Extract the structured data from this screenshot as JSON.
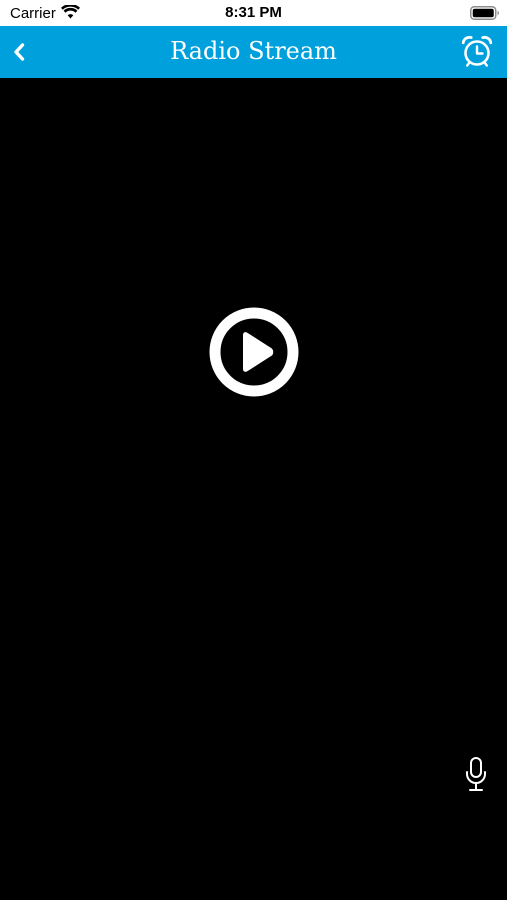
{
  "status_bar": {
    "carrier": "Carrier",
    "time": "8:31 PM",
    "wifi_icon": "wifi-icon",
    "battery_icon": "battery-icon"
  },
  "nav": {
    "title": "Radio Stream",
    "back_icon": "chevron-left-icon",
    "alarm_icon": "alarm-clock-icon",
    "background_color": "#00a0dc",
    "text_color": "#ffffff"
  },
  "player": {
    "play_icon": "play-circle-icon",
    "mic_icon": "microphone-icon",
    "background_color": "#000000"
  }
}
